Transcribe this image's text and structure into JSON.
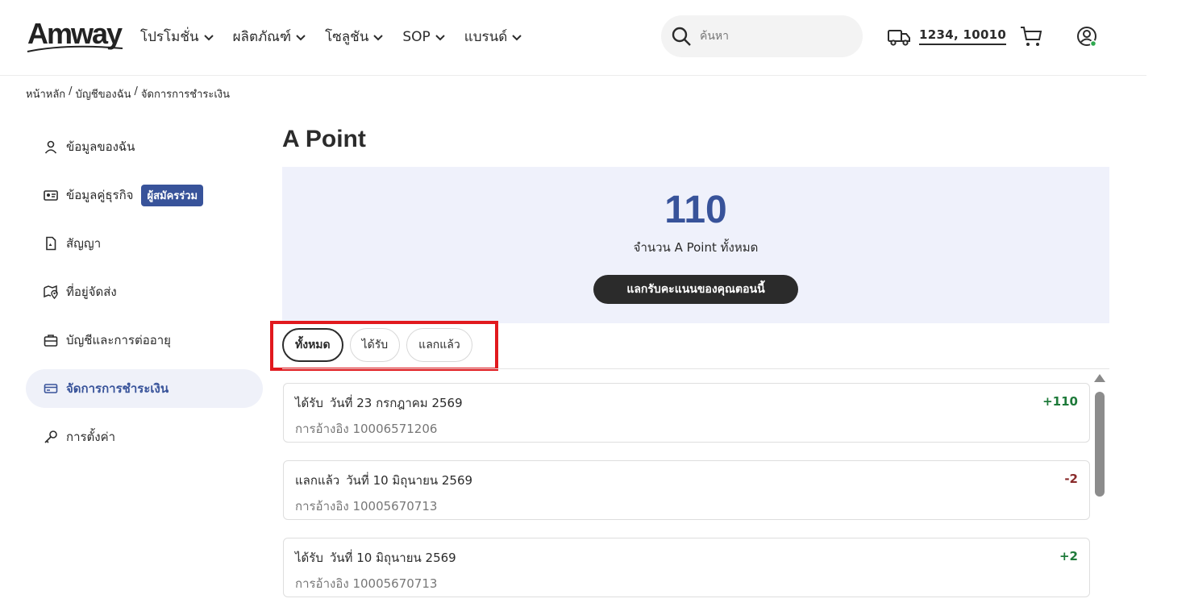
{
  "header": {
    "logo": "Amway",
    "nav": [
      {
        "label": "โปรโมชั่น"
      },
      {
        "label": "ผลิตภัณฑ์"
      },
      {
        "label": "โซลูชัน"
      },
      {
        "label": "SOP"
      },
      {
        "label": "แบรนด์"
      }
    ],
    "search_placeholder": "ค้นหา",
    "delivery_text": "1234, 10010"
  },
  "breadcrumb": [
    "หน้าหลัก",
    "/",
    "บัญชีของฉัน",
    "/",
    "จัดการการชำระเงิน"
  ],
  "sidebar": {
    "items": [
      {
        "label": "ข้อมูลของฉัน",
        "icon": "user-icon"
      },
      {
        "label": "ข้อมูลคู่ธุรกิจ",
        "icon": "id-card-icon",
        "badge": "ผู้สมัครร่วม"
      },
      {
        "label": "สัญญา",
        "icon": "document-icon"
      },
      {
        "label": "ที่อยู่จัดส่ง",
        "icon": "map-pin-icon"
      },
      {
        "label": "บัญชีและการต่ออายุ",
        "icon": "briefcase-icon"
      },
      {
        "label": "จัดการการชำระเงิน",
        "icon": "credit-card-icon",
        "active": true
      },
      {
        "label": "การตั้งค่า",
        "icon": "key-icon"
      }
    ]
  },
  "main": {
    "title": "A Point",
    "summary": {
      "value": "110",
      "label": "จำนวน A Point ทั้งหมด",
      "button": "แลกรับคะแนนของคุณตอนนี้"
    },
    "tabs": [
      {
        "label": "ทั้งหมด",
        "active": true
      },
      {
        "label": "ได้รับ"
      },
      {
        "label": "แลกแล้ว"
      }
    ],
    "transactions": [
      {
        "type": "ได้รับ",
        "date": "วันที่ 23 กรกฎาคม 2569",
        "ref_label": "การอ้างอิง",
        "ref": "10006571206",
        "amount": "+110"
      },
      {
        "type": "แลกแล้ว",
        "date": "วันที่ 10 มิถุนายน 2569",
        "ref_label": "การอ้างอิง",
        "ref": "10005670713",
        "amount": "-2"
      },
      {
        "type": "ได้รับ",
        "date": "วันที่ 10 มิถุนายน 2569",
        "ref_label": "การอ้างอิง",
        "ref": "10005670713",
        "amount": "+2"
      }
    ]
  },
  "colors": {
    "accent": "#38539a",
    "highlight": "#e1191e",
    "positive": "#1e7a3a",
    "negative": "#8a2b2b"
  }
}
